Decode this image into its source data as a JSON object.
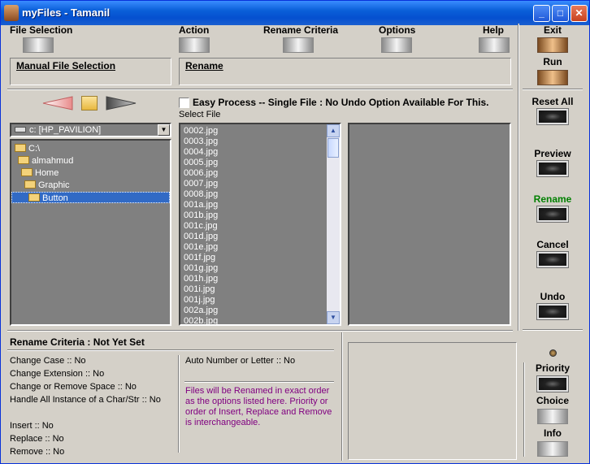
{
  "window": {
    "title": "myFiles - Tamanil"
  },
  "menu": {
    "file_selection": "File Selection",
    "action": "Action",
    "rename_criteria": "Rename Criteria",
    "options": "Options",
    "help": "Help"
  },
  "panels": {
    "manual_file_selection": "Manual File Selection",
    "rename": "Rename"
  },
  "easy_process": {
    "label": "Easy Process -- Single File : No Undo Option Available For This.",
    "checked": false
  },
  "select_file_label": "Select File",
  "drive": {
    "selected": "c: [HP_PAVILION]"
  },
  "tree": [
    "C:\\",
    "almahmud",
    "Home",
    "Graphic",
    "Button"
  ],
  "tree_selected": "Button",
  "files": [
    "0002.jpg",
    "0003.jpg",
    "0004.jpg",
    "0005.jpg",
    "0006.jpg",
    "0007.jpg",
    "0008.jpg",
    "001a.jpg",
    "001b.jpg",
    "001c.jpg",
    "001d.jpg",
    "001e.jpg",
    "001f.jpg",
    "001g.jpg",
    "001h.jpg",
    "001i.jpg",
    "001j.jpg",
    "002a.jpg",
    "002b.jpg"
  ],
  "side": {
    "exit": "Exit",
    "run": "Run",
    "reset_all": "Reset All",
    "preview": "Preview",
    "rename": "Rename",
    "cancel": "Cancel",
    "undo": "Undo",
    "rename_color": "#008000"
  },
  "criteria": {
    "title": "Rename Criteria : Not Yet Set",
    "change_case": "Change Case :: No",
    "change_extension": "Change Extension :: No",
    "change_remove_space": "Change or Remove Space :: No",
    "handle_all": "Handle All Instance of a Char/Str :: No",
    "insert": "Insert :: No",
    "replace": "Replace :: No",
    "remove": "Remove :: No",
    "auto_number": "Auto Number or Letter :: No",
    "note": "Files will be Renamed in exact order as the options listed here. Priority or order of Insert, Replace and Remove is interchangeable.",
    "note_color": "#800080"
  },
  "bottom_right": {
    "priority": "Priority",
    "choice": "Choice",
    "info": "Info"
  }
}
